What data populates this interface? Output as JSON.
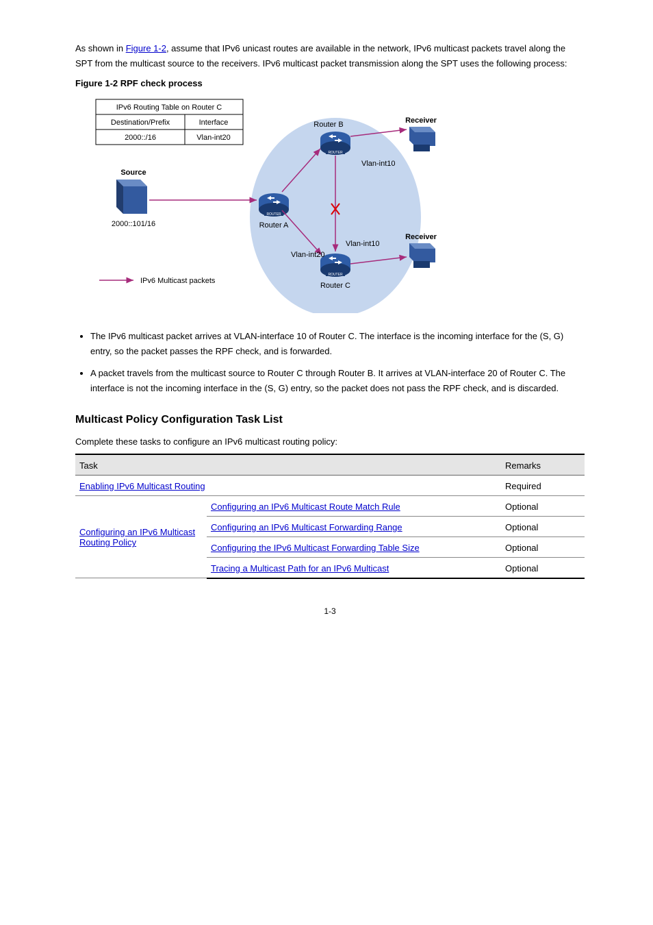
{
  "paras": {
    "p1_a": "As shown in ",
    "p1_link": "Figure 1-2",
    "p1_b": ", assume that IPv6 unicast routes are available in the network, IPv6 multicast packets travel along the SPT from the multicast source to the receivers. IPv6 multicast packet transmission along the SPT uses the following process:"
  },
  "fig_caption": "Figure 1-2 RPF check process",
  "diagram": {
    "routing_table_title": "IPv6 Routing Table on Router C",
    "col1": "Destination/Prefix",
    "col2": "Interface",
    "dest": "2000::/16",
    "iface": "Vlan-int20",
    "source_label": "Source",
    "source_ip": "2000::101/16",
    "router_a": "Router A",
    "router_b": "Router B",
    "router_c": "Router C",
    "vlan_int10_b": "Vlan-int10",
    "vlan_int10_c": "Vlan-int10",
    "vlan_int20_c": "Vlan-int20",
    "receiver": "Receiver",
    "legend": "IPv6 Multicast packets"
  },
  "bullets": {
    "b1": "The IPv6 multicast packet arrives at VLAN-interface 10 of Router C. The interface is the incoming interface for the (S, G) entry, so the packet passes the RPF check, and is forwarded.",
    "b2": "A packet travels from the multicast source to Router C through Router B. It arrives at VLAN-interface 20 of Router C. The interface is not the incoming interface in the (S, G) entry, so the packet does not pass the RPF check, and is discarded."
  },
  "section_heading": "Multicast Policy Configuration Task List",
  "table_caption": "Complete these tasks to configure an IPv6 multicast routing policy:",
  "table": {
    "head": {
      "task": "Task",
      "remarks": "Remarks"
    },
    "rows": [
      {
        "task_left": "Enabling IPv6 Multicast Routing",
        "task_right": "",
        "remarks": "Required",
        "link_left": true
      },
      {
        "task_left": "Configuring an IPv6 Multicast Routing Policy",
        "task_right": "Configuring an IPv6 Multicast Route Match Rule",
        "remarks": "Optional",
        "link_left": true,
        "link_right": true
      },
      {
        "task_left": "",
        "task_right": "Configuring an IPv6 Multicast Forwarding Range",
        "remarks": "Optional",
        "link_left": false,
        "link_right": true
      },
      {
        "task_left": "",
        "task_right": "Configuring the IPv6 Multicast Forwarding Table Size",
        "remarks": "Optional",
        "link_left": false,
        "link_right": true
      },
      {
        "task_left": "",
        "task_right": "Tracing a Multicast Path for an IPv6 Multicast",
        "remarks": "Optional",
        "link_left": false,
        "link_right": true
      }
    ]
  },
  "page_number": "1-3"
}
